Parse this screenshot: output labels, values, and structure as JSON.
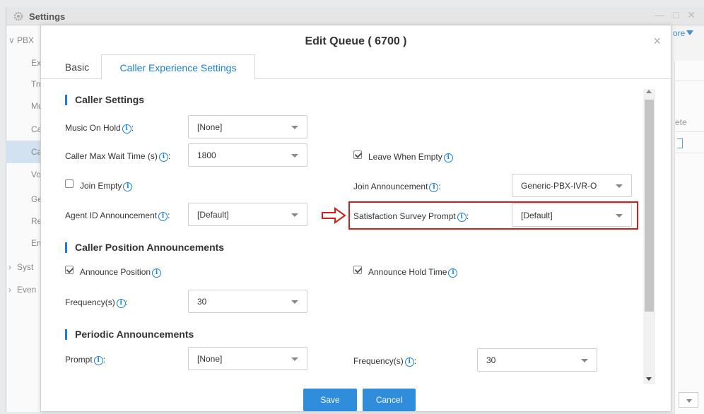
{
  "background": {
    "window_title": "Settings",
    "window_controls": "— □ ✕",
    "nav": [
      {
        "label": "PBX",
        "level": "top",
        "expanded": true
      },
      {
        "label": "Ex",
        "level": "sub"
      },
      {
        "label": "Tru",
        "level": "sub"
      },
      {
        "label": "Mu",
        "level": "sub"
      },
      {
        "label": "Ca",
        "level": "sub"
      },
      {
        "label": "Ca",
        "level": "sub",
        "active": true
      },
      {
        "label": "Vo",
        "level": "sub"
      },
      {
        "label": "Ge",
        "level": "sub"
      },
      {
        "label": "Re",
        "level": "sub"
      },
      {
        "label": "Em",
        "level": "sub"
      },
      {
        "label": "Syst",
        "level": "top"
      },
      {
        "label": "Even",
        "level": "top"
      }
    ],
    "more_label": "ore",
    "column_fragment": "ete"
  },
  "modal": {
    "title": "Edit Queue ( 6700 )",
    "close": "×",
    "tabs": [
      {
        "label": "Basic",
        "active": false
      },
      {
        "label": "Caller Experience Settings",
        "active": true
      }
    ],
    "sections": {
      "caller_settings": "Caller Settings",
      "position_announcements": "Caller Position Announcements",
      "periodic_announcements": "Periodic Announcements"
    },
    "fields": {
      "music_on_hold": {
        "label": "Music On Hold",
        "suffix": ":",
        "value": "[None]"
      },
      "caller_max_wait": {
        "label": "Caller Max Wait Time (s)",
        "suffix": ":",
        "value": "1800"
      },
      "leave_when_empty": {
        "label": "Leave When Empty",
        "checked": true
      },
      "join_empty": {
        "label": "Join Empty",
        "checked": false
      },
      "join_announcement": {
        "label": "Join Announcement",
        "suffix": ":",
        "value": "Generic-PBX-IVR-O"
      },
      "agent_id_announcement": {
        "label": "Agent ID Announcement",
        "suffix": ":",
        "value": "[Default]"
      },
      "satisfaction_survey_prompt": {
        "label": "Satisfaction Survey Prompt",
        "suffix": ":",
        "value": "[Default]"
      },
      "announce_position": {
        "label": "Announce Position",
        "checked": true
      },
      "announce_hold_time": {
        "label": "Announce Hold Time",
        "checked": true
      },
      "position_frequency": {
        "label": "Frequency(s)",
        "suffix": ":",
        "value": "30"
      },
      "prompt": {
        "label": "Prompt",
        "suffix": ":",
        "value": "[None]"
      },
      "periodic_frequency": {
        "label": "Frequency(s)",
        "suffix": ":",
        "value": "30"
      }
    },
    "buttons": {
      "save": "Save",
      "cancel": "Cancel"
    },
    "info_glyph": "i"
  },
  "colors": {
    "accent": "#1a7fd6",
    "button": "#2f8ddb",
    "highlight": "#d81c1c"
  }
}
